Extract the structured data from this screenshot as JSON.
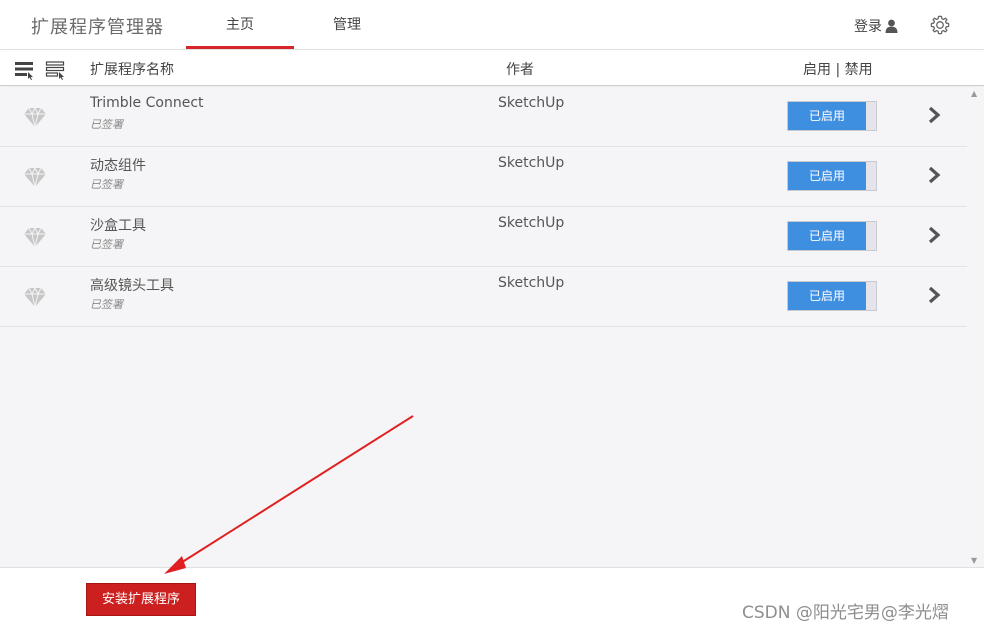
{
  "header": {
    "app_title": "扩展程序管理器",
    "tabs": [
      {
        "label": "主页",
        "active": true
      },
      {
        "label": "管理",
        "active": false
      }
    ],
    "login_label": "登录",
    "login_icon": "user-icon",
    "settings_icon": "gear-icon"
  },
  "columns": {
    "name": "扩展程序名称",
    "author": "作者",
    "enable": "启用 | 禁用"
  },
  "extensions": [
    {
      "name": "Trimble Connect",
      "signed": "已签署",
      "author": "SketchUp",
      "status": "已启用"
    },
    {
      "name": "动态组件",
      "signed": "已签署",
      "author": "SketchUp",
      "status": "已启用"
    },
    {
      "name": "沙盒工具",
      "signed": "已签署",
      "author": "SketchUp",
      "status": "已启用"
    },
    {
      "name": "高级镜头工具",
      "signed": "已签署",
      "author": "SketchUp",
      "status": "已启用"
    }
  ],
  "footer": {
    "install_label": "安装扩展程序"
  },
  "watermark": "CSDN @阳光宅男@李光熠",
  "colors": {
    "accent_red": "#d6262c",
    "toggle_blue": "#3f8fe0",
    "install_red": "#cc1f1f",
    "arrow_red": "#e02020"
  }
}
